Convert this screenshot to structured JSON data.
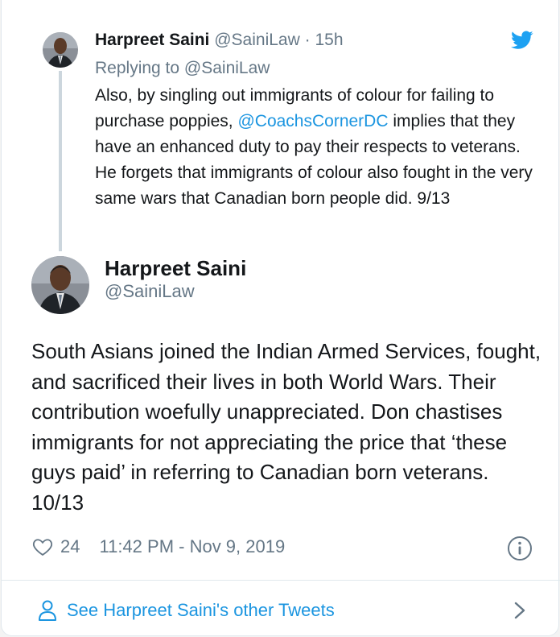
{
  "parent_tweet": {
    "name": "Harpreet Saini",
    "handle": "@SainiLaw",
    "separator": "·",
    "time": "15h",
    "replying_prefix": "Replying to",
    "replying_to": "@SainiLaw",
    "text_before_mention": "Also, by singling out immigrants of colour for failing to purchase poppies, ",
    "mention": "@CoachsCornerDC",
    "text_after_mention": "  implies that they have an enhanced duty to pay their respects to veterans.  He forgets that immigrants of colour also fought in the very same wars that Canadian born people did.  9/13"
  },
  "main_tweet": {
    "name": "Harpreet Saini",
    "handle": "@SainiLaw",
    "text": "South Asians joined the Indian Armed Services, fought, and sacrificed their lives in both World Wars.  Their contribution woefully unappreciated. Don chastises immigrants for not appreciating the price that ‘these guys paid’ in referring to Canadian born veterans.  10/13",
    "likes": "24",
    "timestamp": "11:42 PM - Nov 9, 2019"
  },
  "footer": {
    "label": "See Harpreet Saini's other Tweets"
  },
  "icons": {
    "brand": "twitter-bird-icon",
    "like": "heart-icon",
    "info": "info-icon",
    "profile": "person-icon",
    "more": "chevron-right-icon"
  },
  "colors": {
    "link": "#1b95e0",
    "muted": "#657786",
    "text": "#14171a",
    "thread_line": "#ccd6dd",
    "border": "#e1e8ed"
  }
}
